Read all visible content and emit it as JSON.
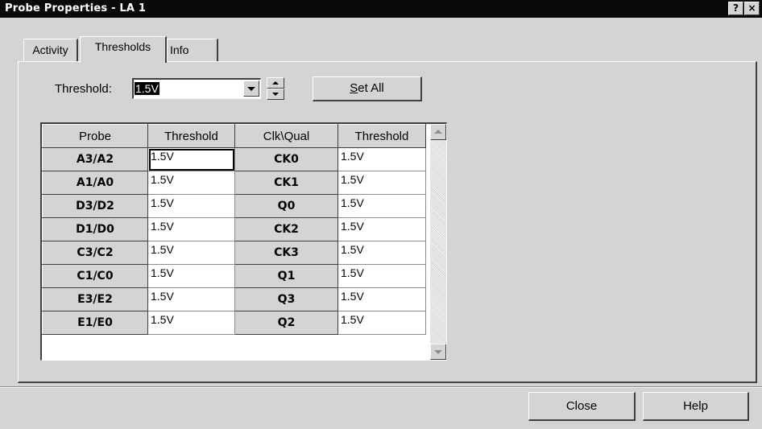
{
  "window": {
    "title": "Probe Properties - LA 1",
    "help_label": "?",
    "close_label": "×"
  },
  "tabs": [
    {
      "label": "Activity",
      "active": false
    },
    {
      "label": "Thresholds",
      "active": true
    },
    {
      "label": "Info",
      "active": false
    }
  ],
  "threshold_control": {
    "label": "Threshold:",
    "value": "1.5V",
    "set_all_label": "Set All",
    "set_all_accel": "S"
  },
  "grid": {
    "headers": [
      "Probe",
      "Threshold",
      "Clk\\Qual",
      "Threshold"
    ],
    "rows": [
      {
        "probe": "A3/A2",
        "threshold": "1.5V",
        "clkqual": "CK0",
        "threshold2": "1.5V"
      },
      {
        "probe": "A1/A0",
        "threshold": "1.5V",
        "clkqual": "CK1",
        "threshold2": "1.5V"
      },
      {
        "probe": "D3/D2",
        "threshold": "1.5V",
        "clkqual": "Q0",
        "threshold2": "1.5V"
      },
      {
        "probe": "D1/D0",
        "threshold": "1.5V",
        "clkqual": "CK2",
        "threshold2": "1.5V"
      },
      {
        "probe": "C3/C2",
        "threshold": "1.5V",
        "clkqual": "CK3",
        "threshold2": "1.5V"
      },
      {
        "probe": "C1/C0",
        "threshold": "1.5V",
        "clkqual": "Q1",
        "threshold2": "1.5V"
      },
      {
        "probe": "E3/E2",
        "threshold": "1.5V",
        "clkqual": "Q3",
        "threshold2": "1.5V"
      },
      {
        "probe": "E1/E0",
        "threshold": "1.5V",
        "clkqual": "Q2",
        "threshold2": "1.5V"
      }
    ]
  },
  "footer": {
    "close_label": "Close",
    "help_label": "Help"
  },
  "icons": {
    "dropdown": "triangle-down-icon",
    "spin_up": "triangle-up-icon",
    "spin_down": "triangle-down-icon",
    "scroll_up": "triangle-up-icon",
    "scroll_down": "triangle-down-icon"
  },
  "colors": {
    "face": "#d4d4d4",
    "titlebar": "#0a0a0a",
    "selection": "#000000"
  }
}
